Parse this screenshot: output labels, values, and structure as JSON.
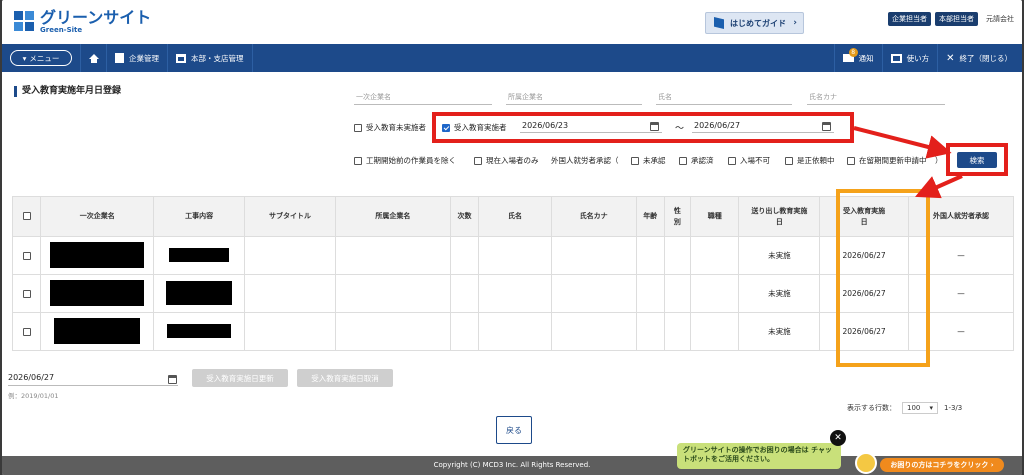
{
  "header": {
    "logo_main": "グリーンサイト",
    "logo_sub": "Green-Site",
    "guide_label": "はじめてガイド",
    "roles": [
      "企業担当者",
      "本部担当者"
    ],
    "company": "元請会社"
  },
  "nav": {
    "menu_label": "メニュー",
    "items": [
      "企業管理",
      "本部・支店管理"
    ],
    "right_items": [
      "通知",
      "使い方",
      "終了（閉じる）"
    ],
    "notif_count": "8"
  },
  "page": {
    "title": "受入教育実施年月日登録"
  },
  "search": {
    "placeholders": [
      "一次企業名",
      "所属企業名",
      "氏名",
      "氏名カナ"
    ],
    "cb_uneducated": "受入教育未実施者",
    "cb_educated": "受入教育実施者",
    "date_from": "2026/06/23",
    "date_sep": "〜",
    "date_to": "2026/06/27",
    "filters": [
      "工期開始前の作業員を除く",
      "現在入場者のみ"
    ],
    "foreign_label": "外国人就労者承認（",
    "foreign_options": [
      "未承認",
      "承認済",
      "入場不可",
      "是正依頼中",
      "在留期間更新申請中"
    ],
    "foreign_close": "）",
    "search_btn": "検索"
  },
  "table": {
    "headers": [
      "一次企業名",
      "工事内容",
      "サブタイトル",
      "所属企業名",
      "次数",
      "氏名",
      "氏名カナ",
      "年齢",
      "性別",
      "職種",
      "送り出し教育実施日",
      "受入教育実施日",
      "外国人就労者承認"
    ],
    "rows": [
      {
        "sendout": "未実施",
        "date": "2026/06/27",
        "foreign": "—"
      },
      {
        "sendout": "未実施",
        "date": "2026/06/27",
        "foreign": "—"
      },
      {
        "sendout": "未実施",
        "date": "2026/06/27",
        "foreign": "—"
      }
    ]
  },
  "bottom": {
    "date_value": "2026/06/27",
    "example": "例：2019/01/01",
    "update_btn": "受入教育実施日更新",
    "cancel_btn": "受入教育実施日取消",
    "rows_label": "表示する行数：",
    "rows_value": "100",
    "page_info": "1-3/3",
    "back_btn": "戻る"
  },
  "footer": {
    "copyright": "Copyright (C) MCD3 Inc. All Rights Reserved."
  },
  "chat": {
    "bubble": "グリーンサイトの操作でお困りの場合は チャットボットをご活用ください。",
    "cta": "お困りの方はコチラをクリック ›"
  }
}
